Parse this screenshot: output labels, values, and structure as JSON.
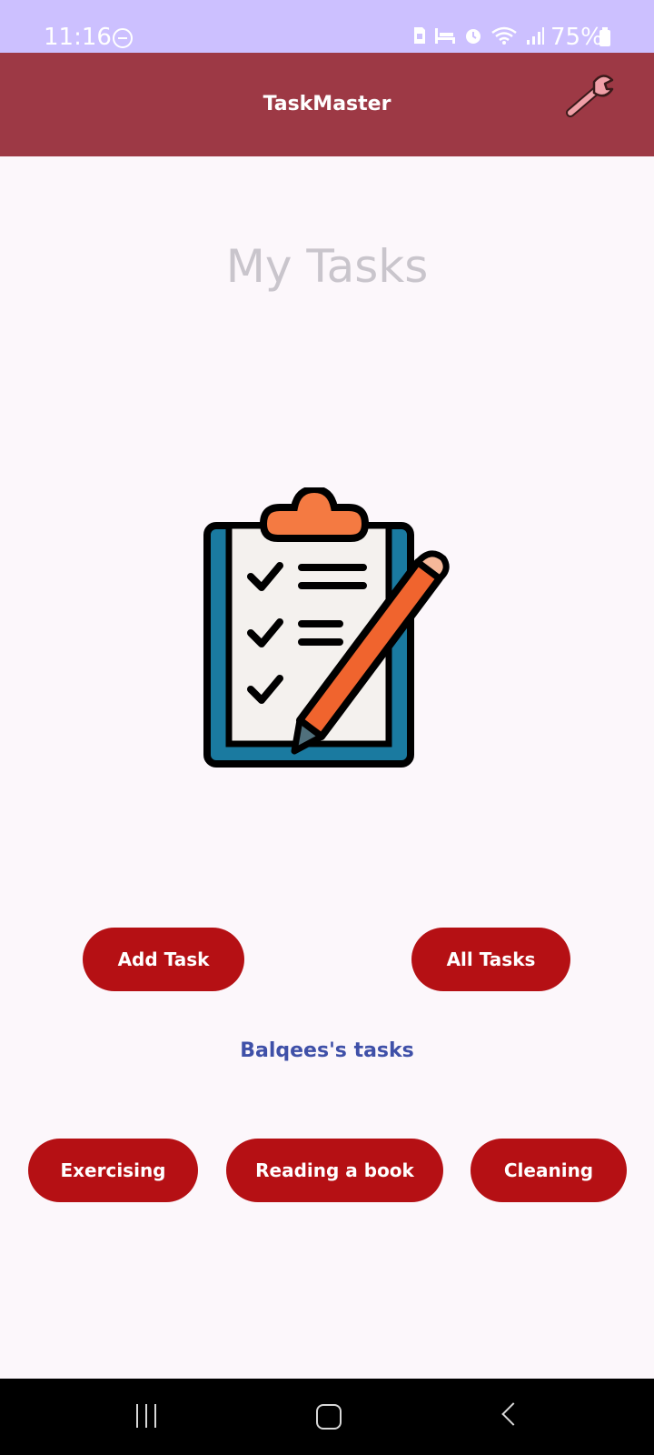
{
  "status_bar": {
    "time": "11:16",
    "battery": "75%",
    "icons": [
      "dnd-icon",
      "sim-icon",
      "bed-icon",
      "alarm-icon",
      "wifi-icon",
      "signal-icon",
      "battery-icon"
    ]
  },
  "app_bar": {
    "title": "TaskMaster",
    "settings_icon": "wrench-icon",
    "color": "#9d3945"
  },
  "main": {
    "title": "My Tasks",
    "illustration": "clipboard-checklist-pencil",
    "add_task_label": "Add Task",
    "all_tasks_label": "All Tasks",
    "user_tasks_label": "Balqees's tasks",
    "task_buttons": [
      "Exercising",
      "Reading a book",
      "Cleaning"
    ]
  },
  "colors": {
    "accent": "#b51014",
    "link": "#3f50a8",
    "status_bar": "#ccc0ff",
    "background": "#fcf7fb"
  },
  "nav_bar": {
    "icons": [
      "recent-apps-icon",
      "home-icon",
      "back-icon"
    ]
  }
}
